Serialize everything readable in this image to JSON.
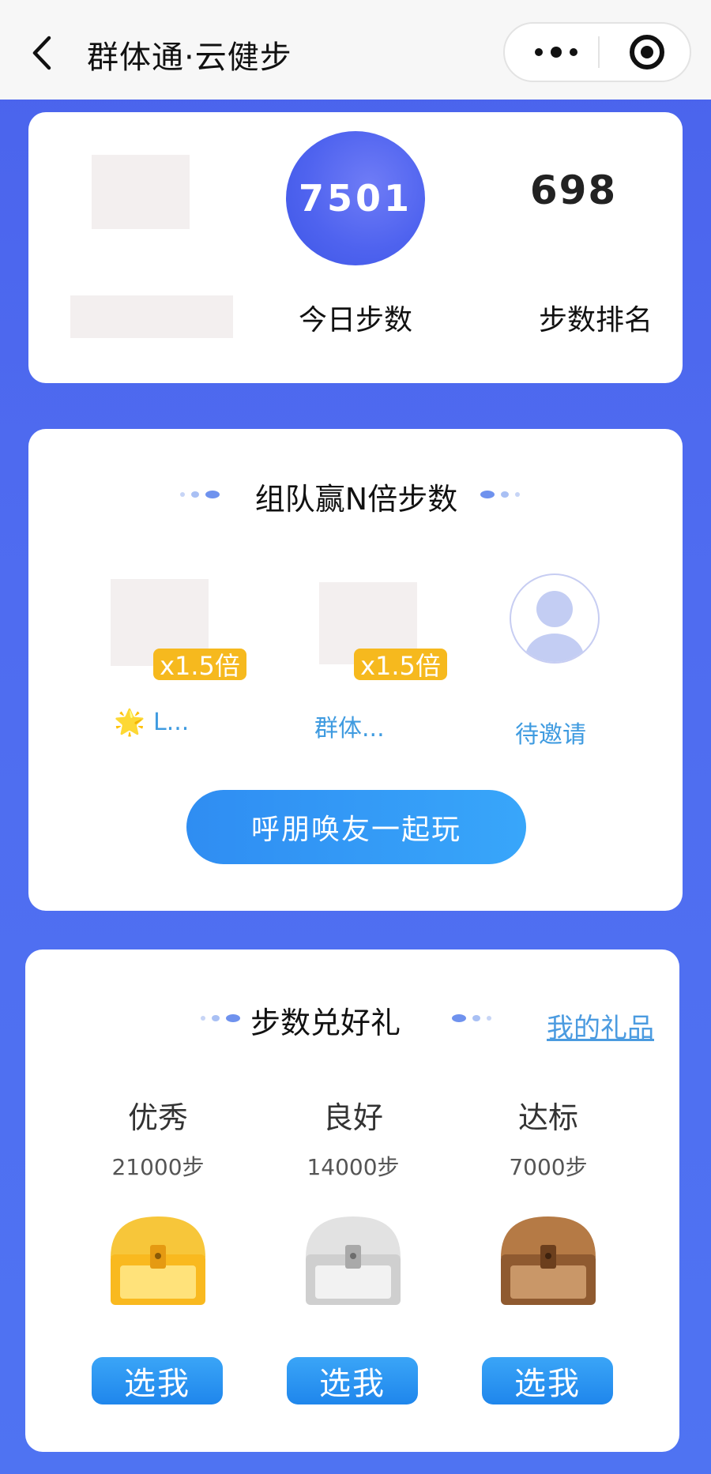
{
  "header": {
    "title": "群体通·云健步"
  },
  "colors": {
    "accent": "#4f63ef",
    "link": "#3f9be0",
    "badge": "#f6b91e",
    "button": "#2f8df2"
  },
  "stats": {
    "today_steps": "7501",
    "today_steps_label": "今日步数",
    "rank": "698",
    "rank_label": "步数排名"
  },
  "team": {
    "title": "组队赢N倍步数",
    "members": [
      {
        "multiplier": "x1.5倍",
        "name": "L...",
        "prefix_icon": "star"
      },
      {
        "multiplier": "x1.5倍",
        "name": "群体..."
      },
      {
        "name": "待邀请",
        "icon": "user-placeholder"
      }
    ],
    "invite_button": "呼朋唤友一起玩"
  },
  "gifts": {
    "title": "步数兑好礼",
    "my_gifts_link": "我的礼品",
    "tiers": [
      {
        "label": "优秀",
        "steps": "21000步",
        "chest": "gold",
        "button": "选我"
      },
      {
        "label": "良好",
        "steps": "14000步",
        "chest": "silver",
        "button": "选我"
      },
      {
        "label": "达标",
        "steps": "7000步",
        "chest": "bronze",
        "button": "选我"
      }
    ]
  }
}
